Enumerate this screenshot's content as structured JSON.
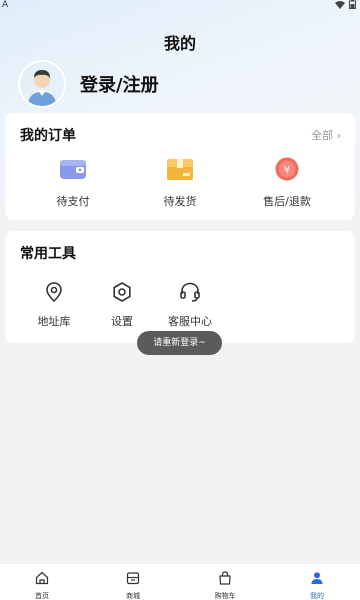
{
  "status_bar": {
    "left_text": "A"
  },
  "header": {
    "title": "我的"
  },
  "profile": {
    "login_label": "登录/注册"
  },
  "orders": {
    "title": "我的订单",
    "all_link": "全部",
    "items": [
      {
        "label": "待支付",
        "icon": "wallet-icon",
        "color": "#7f8ee8"
      },
      {
        "label": "待发货",
        "icon": "package-icon",
        "color": "#f3b33c"
      },
      {
        "label": "售后/退款",
        "icon": "refund-icon",
        "color": "#ef6b5a"
      }
    ]
  },
  "tools": {
    "title": "常用工具",
    "items": [
      {
        "label": "地址库",
        "icon": "location-pin-icon"
      },
      {
        "label": "设置",
        "icon": "settings-gear-icon"
      },
      {
        "label": "客服中心",
        "icon": "headset-icon"
      }
    ]
  },
  "toast": {
    "text": "请重新登录~"
  },
  "tabbar": {
    "tabs": [
      {
        "label": "首页",
        "icon": "home-icon"
      },
      {
        "label": "商城",
        "icon": "store-icon"
      },
      {
        "label": "购物车",
        "icon": "cart-bag-icon"
      },
      {
        "label": "我的",
        "icon": "user-icon"
      }
    ],
    "active_color": "#2f6bd8"
  }
}
